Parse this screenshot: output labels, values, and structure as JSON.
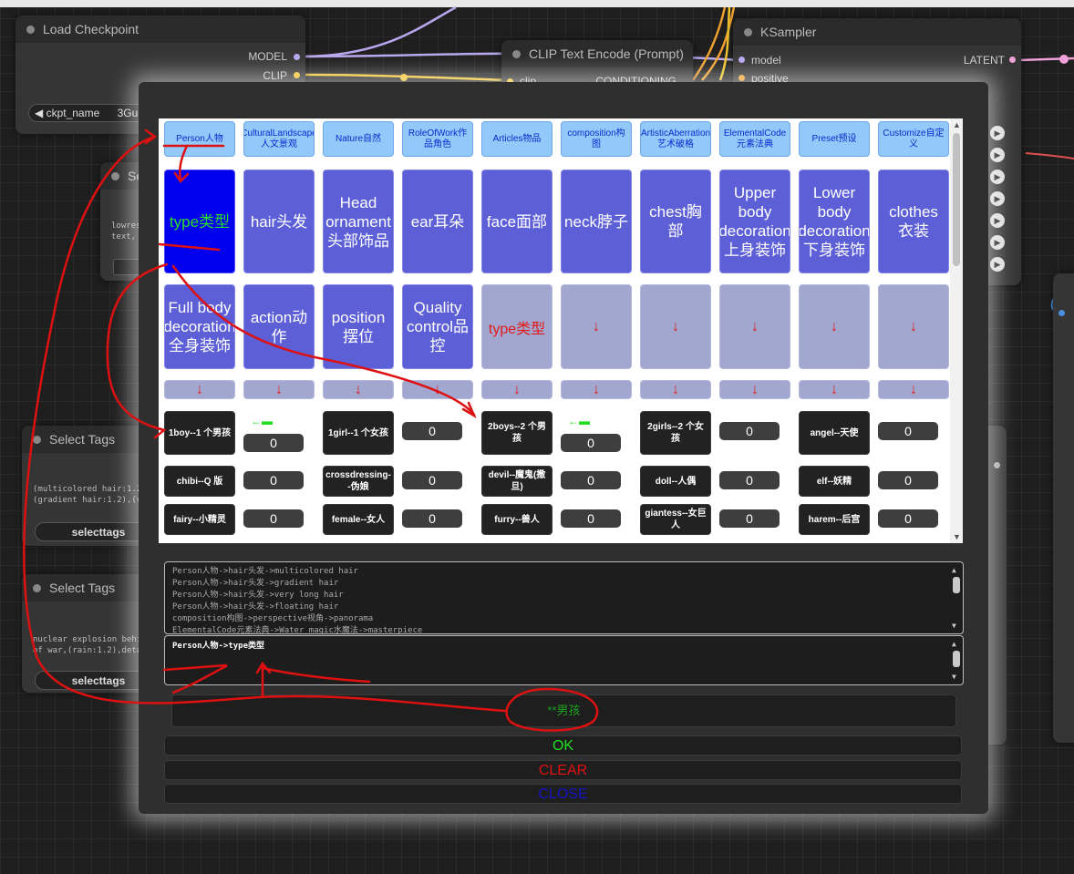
{
  "nodes": {
    "load_checkpoint": {
      "title": "Load Checkpoint",
      "outputs": [
        "MODEL",
        "CLIP"
      ],
      "widget_label": "ckpt_name",
      "widget_value": "3Gu"
    },
    "clip_text_encode": {
      "title": "CLIP Text Encode (Prompt)",
      "input": "clip",
      "output": "CONDITIONING"
    },
    "ksampler": {
      "title": "KSampler",
      "inputs": [
        "model",
        "positive"
      ],
      "output": "LATENT"
    },
    "se_node": {
      "title": "Se",
      "text": "lowres\ntext, "
    },
    "select_tags_1": {
      "title": "Select Tags",
      "text": "(multicolored hair:1.2\n(gradient hair:1.2),(v",
      "button": "selecttags"
    },
    "select_tags_2": {
      "title": "Select Tags",
      "text": "nuclear explosion behi\nof war,(rain:1.2),deta",
      "button": "selecttags"
    }
  },
  "dialog": {
    "categories": [
      "Person人物",
      "CulturalLandscape人文景观",
      "Nature自然",
      "RoleOfWork作品角色",
      "Articles物品",
      "composition构图",
      "ArtisticAberration艺术破格",
      "ElementalCode元素法典",
      "Preset预设",
      "Customize自定义"
    ],
    "subcategories_row1": [
      "type类型",
      "hair头发",
      "Head ornament头部饰品",
      "ear耳朵",
      "face面部",
      "neck脖子",
      "chest胸部",
      "Upper body decoration上身装饰",
      "Lower body decoration下身装饰",
      "clothes衣装"
    ],
    "subcategories_row2": [
      "Full body decoration全身装饰",
      "action动作",
      "position摆位",
      "Quality control品控",
      "type类型",
      "↓",
      "↓",
      "↓",
      "↓",
      "↓"
    ],
    "arrow_symbol": "↓",
    "selected_subcategory": "type类型",
    "green_arrow": "←",
    "tags": [
      {
        "label": "1boy--1 个男孩",
        "count": "0"
      },
      {
        "label": "1girl--1 个女孩",
        "count": "0"
      },
      {
        "label": "2boys--2 个男孩",
        "count": "0"
      },
      {
        "label": "2girls--2 个女孩",
        "count": "0"
      },
      {
        "label": "angel--天使",
        "count": "0"
      },
      {
        "label": "chibi--Q 版",
        "count": "0"
      },
      {
        "label": "crossdressing--伪娘",
        "count": "0"
      },
      {
        "label": "devil--魔鬼(撒旦)",
        "count": "0"
      },
      {
        "label": "doll--人偶",
        "count": "0"
      },
      {
        "label": "elf--妖精",
        "count": "0"
      },
      {
        "label": "fairy--小精灵",
        "count": "0"
      },
      {
        "label": "female--女人",
        "count": "0"
      },
      {
        "label": "furry--兽人",
        "count": "0"
      },
      {
        "label": "giantess--女巨人",
        "count": "0"
      },
      {
        "label": "harem--后宫",
        "count": "0"
      }
    ],
    "history_lines": [
      "Person人物->hair头发->multicolored hair",
      "Person人物->hair头发->gradient hair",
      "Person人物->hair头发->very long hair",
      "Person人物->hair头发->floating hair",
      "composition构图->perspective视角->panorama",
      "ElementalCode元素法典->Water magic水魔法->masterpiece"
    ],
    "current_path": "Person人物->type类型",
    "search_value": "**男孩",
    "buttons": {
      "ok": "OK",
      "clear": "CLEAR",
      "close": "CLOSE"
    }
  },
  "colors": {
    "ok": "#22dd22",
    "clear": "#e01010",
    "close": "#1515c8",
    "annotation": "#dd1111"
  }
}
